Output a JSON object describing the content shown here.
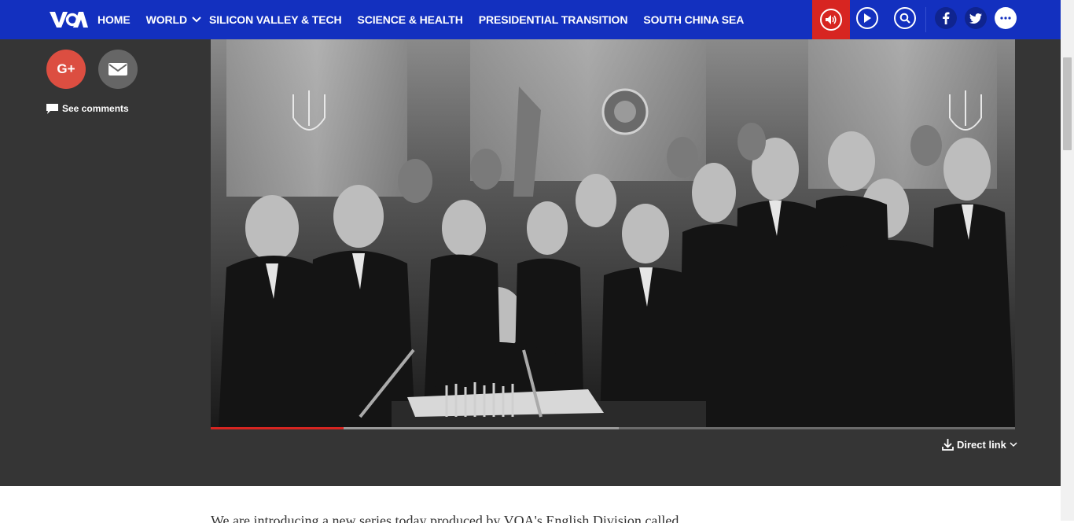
{
  "nav": {
    "logo": "VOA",
    "items": [
      {
        "label": "HOME"
      },
      {
        "label": "WORLD"
      },
      {
        "label": "SILICON VALLEY & TECH"
      },
      {
        "label": "SCIENCE & HEALTH"
      },
      {
        "label": "PRESIDENTIAL TRANSITION"
      },
      {
        "label": "SOUTH CHINA SEA"
      }
    ]
  },
  "share": {
    "google_plus": "G+",
    "see_comments": "See comments"
  },
  "media": {
    "progress_played": 0.165,
    "progress_buffered": 0.507,
    "direct_link": "Direct link"
  },
  "article": {
    "first_line": "We are introducing a new series today produced by VOA's English Division called"
  },
  "colors": {
    "nav_bg": "#1330bf",
    "accent_red": "#d72521",
    "media_bg": "#353535"
  },
  "icons": [
    "voa-logo",
    "chevron-down-icon",
    "speaker-icon",
    "play-icon",
    "search-icon",
    "facebook-icon",
    "twitter-icon",
    "more-icon",
    "mail-icon",
    "comment-icon",
    "download-icon"
  ]
}
